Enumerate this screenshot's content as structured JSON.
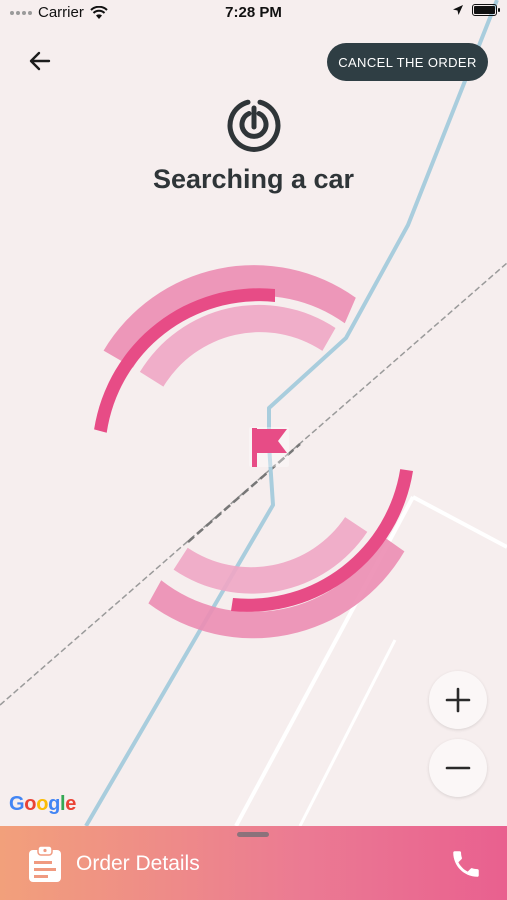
{
  "status_bar": {
    "carrier": "Carrier",
    "time": "7:28 PM"
  },
  "header": {
    "back_icon": "arrow-left-icon",
    "cancel_label": "CANCEL THE ORDER",
    "search_icon": "radar-icon",
    "title": "Searching a car"
  },
  "map": {
    "destination_icon": "flag-icon",
    "zoom_in_label": "+",
    "zoom_out_label": "−",
    "attribution": "Google",
    "colors": {
      "background": "#f6eeee",
      "route": "#a9cddd",
      "arc_light": "#f0a6c4",
      "arc_mid": "#ec8db3",
      "arc_dark": "#e74c86",
      "flag": "#e74c86"
    }
  },
  "bottom_bar": {
    "order_details_label": "Order Details",
    "order_icon": "clipboard-icon",
    "phone_icon": "phone-icon"
  }
}
